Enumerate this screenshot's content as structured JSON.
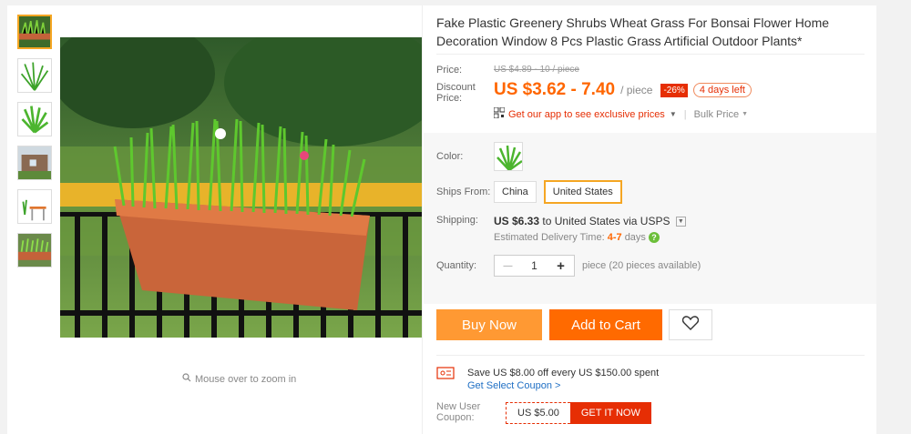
{
  "title": "Fake Plastic Greenery Shrubs Wheat Grass For Bonsai Flower Home Decoration Window 8 Pcs Plastic Grass Artificial Outdoor Plants*",
  "zoom_hint": "Mouse over to zoom in",
  "price": {
    "label": "Price:",
    "original": "US $4.89 - 10 / piece",
    "discount_label": "Discount Price:",
    "current": "US $3.62 - 7.40",
    "unit": "/ piece",
    "off_badge": "-26%",
    "days_left": "4 days left"
  },
  "app_promo": {
    "text": "Get our app to see exclusive prices",
    "bulk": "Bulk Price"
  },
  "color": {
    "label": "Color:"
  },
  "ships_from": {
    "label": "Ships From:",
    "options": [
      "China",
      "United States"
    ],
    "selected": "United States"
  },
  "shipping": {
    "label": "Shipping:",
    "cost": "US $6.33",
    "to": " to United States via USPS",
    "est_label": "Estimated Delivery Time:",
    "est_days": "4-7",
    "est_unit": "days"
  },
  "quantity": {
    "label": "Quantity:",
    "value": "1",
    "minus": "—",
    "plus": "+",
    "available": "piece (20 pieces available)"
  },
  "buttons": {
    "buy_now": "Buy Now",
    "add_to_cart": "Add to Cart"
  },
  "coupon": {
    "save_text": "Save US $8.00 off every US $150.00 spent",
    "link": "Get Select Coupon >",
    "new_user_label": "New User Coupon:",
    "value": "US $5.00",
    "get": "GET IT NOW"
  },
  "colors": {
    "accent": "#ff6a00",
    "buy": "#ff9933",
    "red": "#e62e04",
    "select": "#f5a623"
  }
}
